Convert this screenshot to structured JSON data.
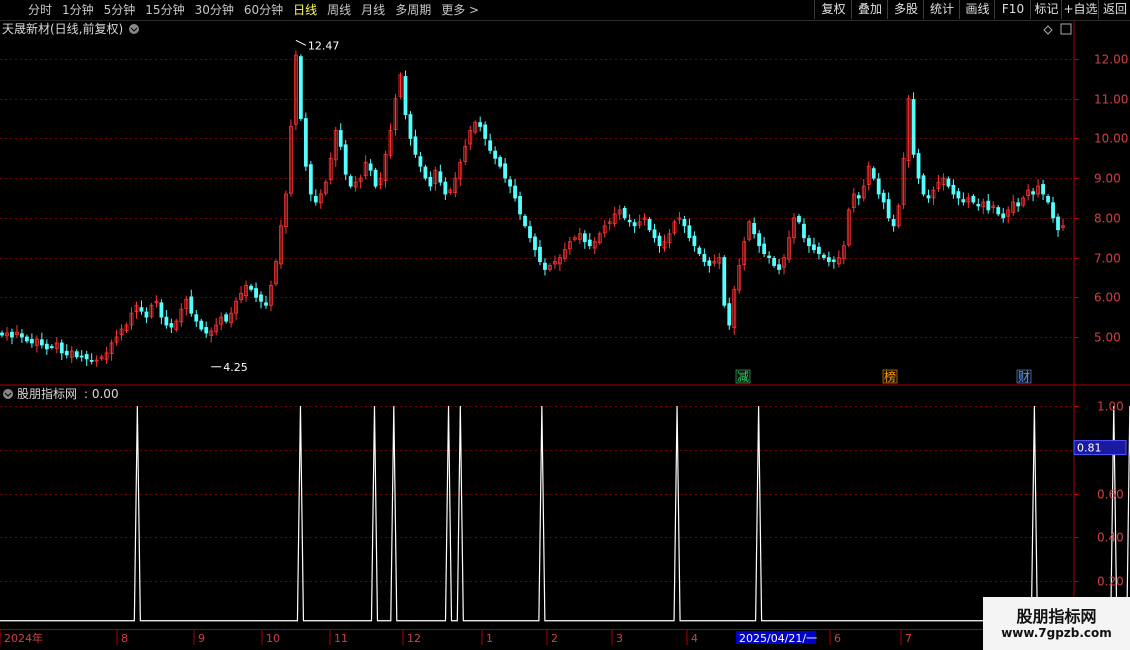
{
  "toolbar": {
    "periods": [
      "分时",
      "1分钟",
      "5分钟",
      "15分钟",
      "30分钟",
      "60分钟",
      "日线",
      "周线",
      "月线",
      "多周期",
      "更多 >"
    ],
    "active_period": "日线",
    "buttons": [
      "复权",
      "叠加",
      "多股",
      "统计",
      "画线",
      "F10",
      "标记",
      "+自选",
      "返回"
    ]
  },
  "main_chart": {
    "title": "天晟新材(日线,前复权)",
    "high_label": "12.47",
    "low_label": "4.25",
    "y_ticks": [
      "12.00",
      "11.00",
      "10.00",
      "9.00",
      "8.00",
      "7.00",
      "6.00",
      "5.00"
    ],
    "markers": [
      {
        "label": "减",
        "color": "#33cc66"
      },
      {
        "label": "榜",
        "color": "#ff9900"
      },
      {
        "label": "财",
        "color": "#5599ff"
      }
    ]
  },
  "indicator": {
    "title": "股朋指标网",
    "value_text": ": 0.00",
    "y_ticks": [
      "1.00",
      "0.80",
      "0.60",
      "0.40",
      "0.20"
    ],
    "current_value": "0.81"
  },
  "time_axis": {
    "labels": [
      "2024年",
      "8",
      "9",
      "10",
      "11",
      "12",
      "1",
      "2",
      "3",
      "4",
      "2025/04/21/一",
      "6",
      "7"
    ]
  },
  "watermark": {
    "title": "股朋指标网",
    "url": "www.7gpzb.com"
  },
  "colors": {
    "up": "#ff3333",
    "down": "#54ffff",
    "grid": "#7a0000",
    "axis": "#aa0000",
    "line": "#ffffff"
  },
  "chart_data": [
    {
      "type": "candlestick",
      "title": "天晟新材(日线,前复权)",
      "ylim": [
        4.0,
        12.7
      ],
      "x_labels": [
        "2024年",
        "8",
        "9",
        "10",
        "11",
        "12",
        "1",
        "2",
        "3",
        "4",
        "2025/04/21/一",
        "6",
        "7"
      ],
      "annotations": [
        {
          "label": "12.47",
          "value": 12.47
        },
        {
          "label": "4.25",
          "value": 4.25
        }
      ],
      "close_series": [
        5.05,
        5.1,
        5.0,
        5.12,
        5.0,
        4.9,
        4.85,
        4.95,
        4.8,
        4.7,
        4.75,
        4.85,
        4.6,
        4.55,
        4.65,
        4.5,
        4.5,
        4.45,
        4.4,
        4.42,
        4.5,
        4.6,
        4.85,
        5.0,
        5.2,
        5.3,
        5.6,
        5.8,
        5.65,
        5.5,
        5.8,
        5.9,
        5.5,
        5.3,
        5.25,
        5.4,
        5.7,
        5.95,
        5.6,
        5.4,
        5.2,
        5.1,
        5.15,
        5.3,
        5.5,
        5.4,
        5.6,
        5.9,
        6.1,
        6.3,
        6.2,
        6.0,
        5.9,
        5.8,
        6.3,
        6.9,
        7.8,
        8.6,
        10.3,
        12.1,
        10.5,
        9.3,
        8.6,
        8.4,
        8.6,
        8.9,
        9.5,
        10.2,
        9.8,
        9.1,
        8.8,
        8.9,
        9.0,
        9.4,
        9.2,
        8.8,
        9.0,
        9.6,
        10.2,
        11.0,
        11.6,
        10.6,
        10.0,
        9.6,
        9.3,
        9.0,
        8.8,
        9.2,
        8.9,
        8.6,
        8.7,
        9.0,
        9.4,
        9.8,
        10.2,
        10.4,
        10.3,
        10.0,
        9.7,
        9.5,
        9.3,
        9.0,
        8.8,
        8.5,
        8.1,
        7.8,
        7.5,
        7.2,
        6.9,
        6.7,
        6.8,
        6.9,
        7.0,
        7.2,
        7.4,
        7.5,
        7.6,
        7.4,
        7.3,
        7.4,
        7.6,
        7.8,
        7.9,
        8.1,
        8.2,
        8.0,
        7.9,
        7.8,
        7.9,
        8.0,
        7.7,
        7.5,
        7.3,
        7.4,
        7.6,
        7.9,
        8.0,
        7.8,
        7.5,
        7.3,
        7.1,
        6.9,
        6.8,
        6.9,
        7.0,
        5.8,
        5.3,
        6.2,
        6.8,
        7.4,
        7.9,
        7.6,
        7.3,
        7.1,
        7.0,
        6.8,
        6.7,
        7.0,
        7.5,
        8.0,
        7.9,
        7.5,
        7.3,
        7.2,
        7.1,
        7.0,
        6.9,
        6.9,
        7.0,
        7.3,
        8.2,
        8.6,
        8.5,
        8.8,
        9.3,
        9.0,
        8.6,
        8.4,
        8.0,
        7.8,
        8.3,
        9.5,
        11.0,
        9.6,
        9.0,
        8.6,
        8.5,
        8.7,
        8.9,
        9.0,
        8.8,
        8.6,
        8.5,
        8.4,
        8.5,
        8.4,
        8.3,
        8.4,
        8.2,
        8.3,
        8.1,
        8.0,
        8.2,
        8.4,
        8.3,
        8.5,
        8.7,
        8.6,
        8.8,
        8.6,
        8.4,
        8.0,
        7.7,
        7.8
      ]
    },
    {
      "type": "line",
      "title": "股朋指标网",
      "ylim": [
        0.0,
        1.05
      ],
      "spikes": [
        0.128,
        0.28,
        0.349,
        0.367,
        0.418,
        0.429,
        0.505,
        0.631,
        0.707,
        0.964,
        1.038,
        1.053
      ],
      "current_value": 0.81
    }
  ]
}
